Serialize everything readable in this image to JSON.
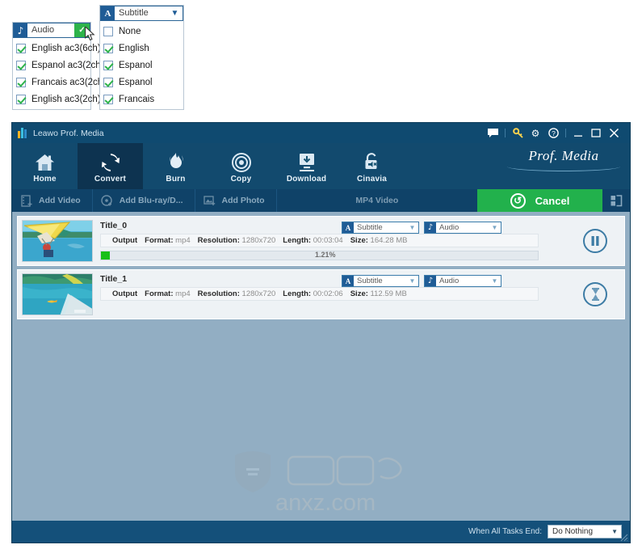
{
  "popups": {
    "audio": {
      "header_label": "Audio",
      "header_icon": "music-note-icon",
      "items": [
        {
          "label": "English ac3(6ch)",
          "checked": true
        },
        {
          "label": "Espanol ac3(2ch)",
          "checked": true
        },
        {
          "label": "Francais ac3(2ch)",
          "checked": true
        },
        {
          "label": "English ac3(2ch)",
          "checked": true
        }
      ]
    },
    "subtitle": {
      "header_label": "Subtitle",
      "header_icon": "letter-a-icon",
      "items": [
        {
          "label": "None",
          "checked": false
        },
        {
          "label": "English",
          "checked": true
        },
        {
          "label": "Espanol",
          "checked": true
        },
        {
          "label": "Espanol",
          "checked": true
        },
        {
          "label": "Francais",
          "checked": true
        }
      ]
    }
  },
  "window": {
    "title": "Leawo Prof. Media",
    "brand": "Prof. Media",
    "title_icons": [
      {
        "name": "feedback-icon",
        "glyph": "⬛"
      },
      {
        "name": "key-icon",
        "glyph": "⚿"
      },
      {
        "name": "settings-gear-icon",
        "glyph": "⚙"
      },
      {
        "name": "help-icon",
        "glyph": "?"
      },
      {
        "name": "minimize-icon",
        "glyph": "—"
      },
      {
        "name": "maximize-icon",
        "glyph": "□"
      },
      {
        "name": "close-icon",
        "glyph": "✕"
      }
    ]
  },
  "nav": {
    "items": [
      {
        "label": "Home",
        "icon": "home-icon",
        "active": false
      },
      {
        "label": "Convert",
        "icon": "convert-refresh-icon",
        "active": true
      },
      {
        "label": "Burn",
        "icon": "flame-icon",
        "active": false
      },
      {
        "label": "Copy",
        "icon": "disc-icon",
        "active": false
      },
      {
        "label": "Download",
        "icon": "download-icon",
        "active": false
      },
      {
        "label": "Cinavia",
        "icon": "cinavia-lock-icon",
        "active": false
      }
    ]
  },
  "actionbar": {
    "add_video": "Add Video",
    "add_bluray": "Add Blu-ray/D...",
    "add_photo": "Add Photo",
    "format_label": "MP4 Video",
    "cancel_label": "Cancel"
  },
  "tasks": [
    {
      "title": "Title_0",
      "output_label": "Output",
      "format_key": "Format:",
      "format_value": "mp4",
      "resolution_key": "Resolution:",
      "resolution_value": "1280x720",
      "length_key": "Length:",
      "length_value": "00:03:04",
      "size_key": "Size:",
      "size_value": "164.28 MB",
      "progress_pct": "1.21%",
      "progress_value": 1.21,
      "subtitle_label": "Subtitle",
      "audio_label": "Audio",
      "action_icon": "pause-icon",
      "thumb": "hang-glider-thumbnail"
    },
    {
      "title": "Title_1",
      "output_label": "Output",
      "format_key": "Format:",
      "format_value": "mp4",
      "resolution_key": "Resolution:",
      "resolution_value": "1280x720",
      "length_key": "Length:",
      "length_value": "00:02:06",
      "size_key": "Size:",
      "size_value": "112.59 MB",
      "progress_pct": "",
      "progress_value": 0,
      "subtitle_label": "Subtitle",
      "audio_label": "Audio",
      "action_icon": "hourglass-icon",
      "thumb": "lagoon-thumbnail"
    }
  ],
  "statusbar": {
    "label": "When All Tasks End:",
    "selected": "Do Nothing"
  },
  "colors": {
    "accent_green": "#22b14c",
    "window_blue": "#124a6e",
    "titlebar_blue": "#0f4a70",
    "content_bg": "#92aec3",
    "progress_green": "#18c018"
  }
}
